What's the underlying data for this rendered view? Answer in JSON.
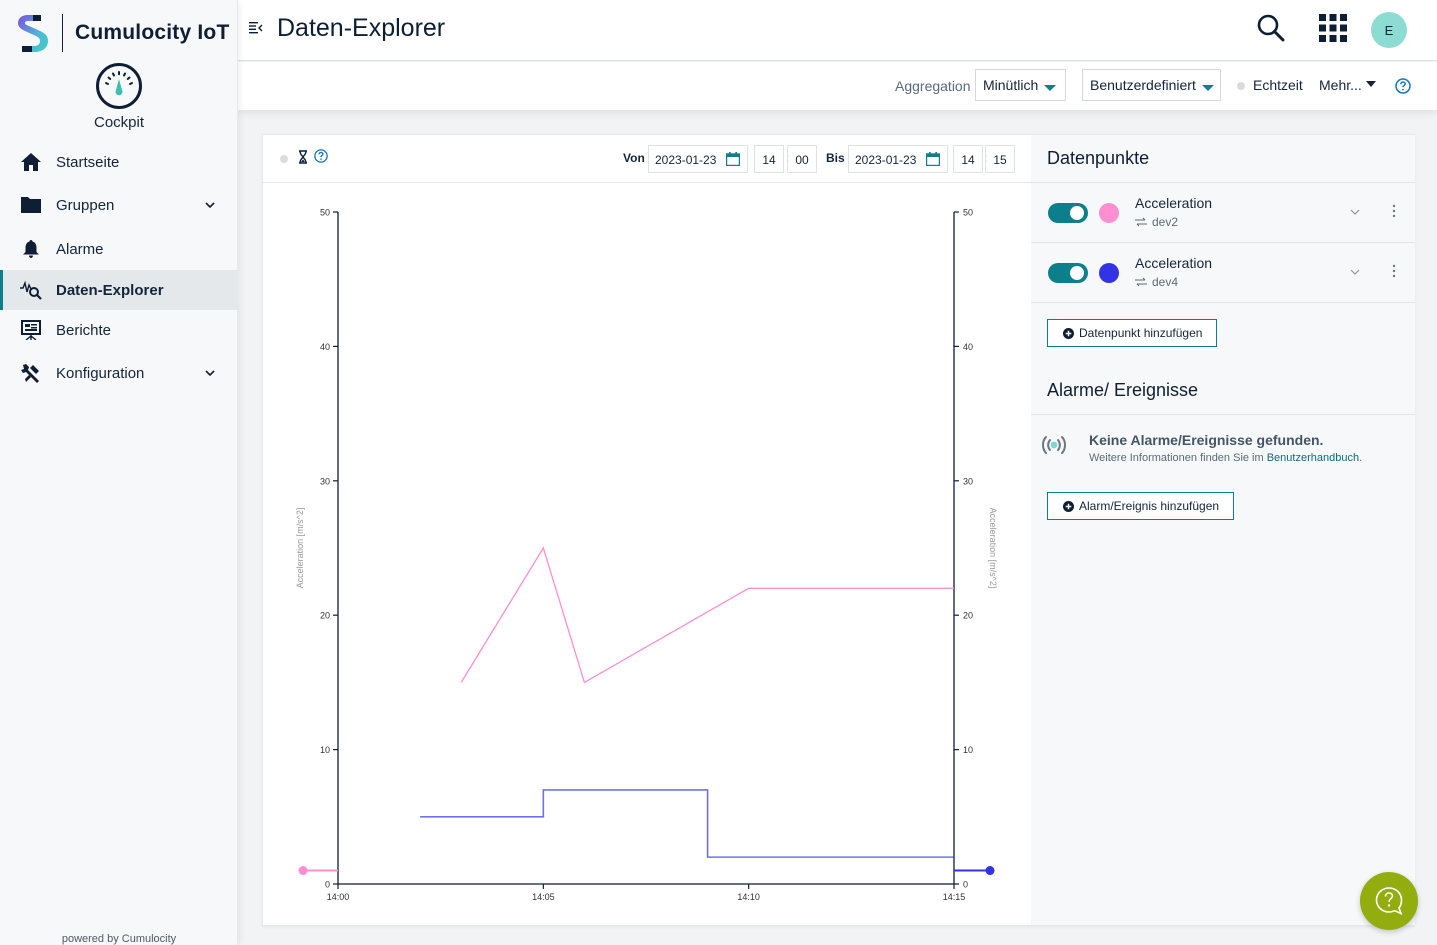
{
  "brand": {
    "name": "Cumulocity IoT"
  },
  "app": {
    "name": "Cockpit",
    "icon": "gauge-icon"
  },
  "sidebar": {
    "items": [
      {
        "label": "Startseite",
        "icon": "home-icon",
        "expandable": false,
        "active": false
      },
      {
        "label": "Gruppen",
        "icon": "folder-icon",
        "expandable": true,
        "active": false
      },
      {
        "label": "Alarme",
        "icon": "bell-icon",
        "expandable": false,
        "active": false
      },
      {
        "label": "Daten-Explorer",
        "icon": "data-explorer-icon",
        "expandable": false,
        "active": true
      },
      {
        "label": "Berichte",
        "icon": "report-icon",
        "expandable": false,
        "active": false
      },
      {
        "label": "Konfiguration",
        "icon": "tools-icon",
        "expandable": true,
        "active": false
      }
    ],
    "footer": "powered by Cumulocity"
  },
  "header": {
    "title": "Daten-Explorer",
    "user_initial": "E"
  },
  "actionbar": {
    "aggregation_label": "Aggregation",
    "aggregation_value": "Minütlich",
    "range_value": "Benutzerdefiniert",
    "realtime_label": "Echtzeit",
    "realtime_active": false,
    "more_label": "Mehr..."
  },
  "chart_toolbar": {
    "from_label": "Von",
    "from_date": "2023-01-23",
    "from_hour": "14",
    "from_minute": "00",
    "to_label": "Bis",
    "to_date": "2023-01-23",
    "to_hour": "14",
    "to_minute": "15",
    "time_separator": ":"
  },
  "datapoints": {
    "title": "Datenpunkte",
    "items": [
      {
        "name": "Acceleration",
        "device": "dev2",
        "color": "#ff8fd1",
        "enabled": true
      },
      {
        "name": "Acceleration",
        "device": "dev4",
        "color": "#3333e6",
        "enabled": true
      }
    ],
    "add_label": "Datenpunkt hinzufügen"
  },
  "alarms": {
    "title": "Alarme/ Ereignisse",
    "empty_title": "Keine Alarme/Ereignisse gefunden.",
    "empty_sub_prefix": "Weitere Informationen finden Sie im ",
    "empty_sub_link": "Benutzerhandbuch",
    "empty_sub_suffix": ".",
    "add_label": "Alarm/Ereignis hinzufügen"
  },
  "colors": {
    "accent": "#0b7f8b",
    "fab": "#92ad0d",
    "series_dev2": "#ff8fd1",
    "series_dev4": "#3333e6"
  },
  "chart_data": {
    "type": "line",
    "title": "",
    "xlabel": "",
    "ylabel_left": "Acceleration [m/s^2]",
    "ylabel_right": "Acceleration [m/s^2]",
    "x_ticks": [
      "14:00",
      "14:05",
      "14:10",
      "14:15"
    ],
    "x_range_minutes": [
      0,
      15
    ],
    "y_ticks": [
      0,
      10,
      20,
      30,
      40,
      50
    ],
    "ylim": [
      0,
      50
    ],
    "grid": false,
    "series": [
      {
        "name": "Acceleration (dev2)",
        "color": "#ff8fd1",
        "axis": "left",
        "interpolation": "linear",
        "points": [
          [
            3,
            15
          ],
          [
            5,
            25
          ],
          [
            6,
            15
          ],
          [
            10,
            22
          ],
          [
            15,
            22
          ]
        ],
        "offscreen_marker": {
          "side": "left",
          "value": 1
        }
      },
      {
        "name": "Acceleration (dev4)",
        "color": "#3333e6",
        "axis": "right",
        "interpolation": "step",
        "points": [
          [
            2,
            5
          ],
          [
            5,
            7
          ],
          [
            9,
            2
          ],
          [
            15,
            2
          ]
        ],
        "offscreen_marker": {
          "side": "right",
          "value": 1
        }
      }
    ]
  }
}
